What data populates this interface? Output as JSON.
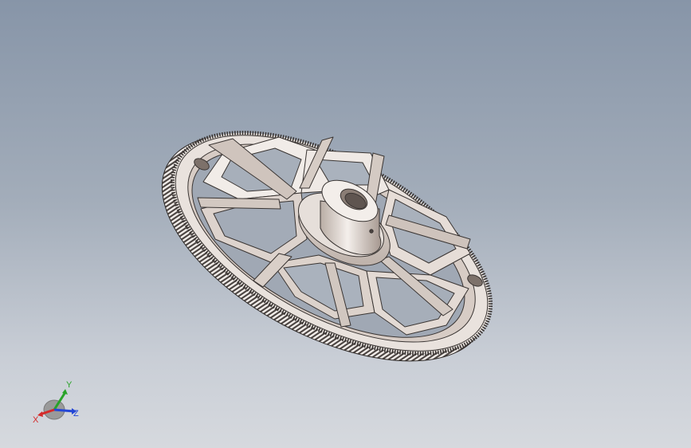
{
  "model": {
    "name": "spur-gear",
    "colors": {
      "background_top": "#8795a8",
      "background_bottom": "#d6d9de",
      "body_light": "#efe9e4",
      "body_mid": "#d9cfc8",
      "body_shadow": "#9d8f86",
      "edge": "#3a3533"
    }
  },
  "triad": {
    "x_label": "X",
    "y_label": "Y",
    "z_label": "Z",
    "x_color": "#d42a2a",
    "y_color": "#29a329",
    "z_color": "#2447d6"
  }
}
